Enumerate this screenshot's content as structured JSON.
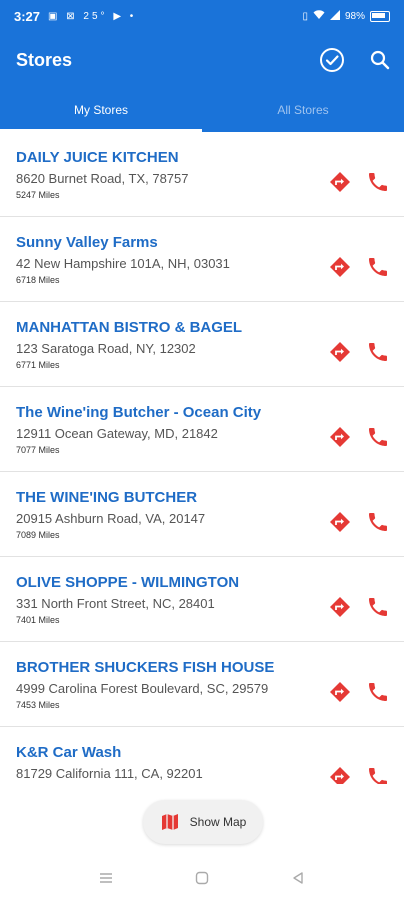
{
  "status_bar": {
    "time": "3:27",
    "indicators": "▣ ⊠ 25° ▶ •",
    "right_text": "98%"
  },
  "app_bar": {
    "title": "Stores",
    "actions": [
      "check-circle-icon",
      "search-icon"
    ]
  },
  "tabs": [
    {
      "label": "My Stores",
      "active": true
    },
    {
      "label": "All Stores",
      "active": false
    }
  ],
  "stores": [
    {
      "name": "DAILY JUICE KITCHEN",
      "address": "8620 Burnet Road, TX, 78757",
      "distance": "5247 Miles"
    },
    {
      "name": "Sunny Valley Farms",
      "address": "42 New Hampshire 101A, NH, 03031",
      "distance": "6718 Miles"
    },
    {
      "name": "MANHATTAN BISTRO & BAGEL",
      "address": "123 Saratoga Road, NY, 12302",
      "distance": "6771 Miles"
    },
    {
      "name": "The Wine'ing Butcher - Ocean City",
      "address": "12911 Ocean Gateway, MD, 21842",
      "distance": "7077 Miles"
    },
    {
      "name": "THE WINE'ING BUTCHER",
      "address": "20915 Ashburn Road, VA, 20147",
      "distance": "7089 Miles"
    },
    {
      "name": "OLIVE SHOPPE - WILMINGTON",
      "address": "331 North Front Street, NC, 28401",
      "distance": "7401 Miles"
    },
    {
      "name": "BROTHER SHUCKERS FISH HOUSE",
      "address": "4999 Carolina Forest Boulevard, SC, 29579",
      "distance": "7453 Miles"
    },
    {
      "name": "K&R Car Wash",
      "address": "81729 California 111, CA, 92201",
      "distance": ""
    }
  ],
  "map_button": {
    "label": "Show Map",
    "icon": "map-icon"
  },
  "colors": {
    "primary": "#1a73d9",
    "accent": "#e53935",
    "link": "#1f6cc6"
  }
}
